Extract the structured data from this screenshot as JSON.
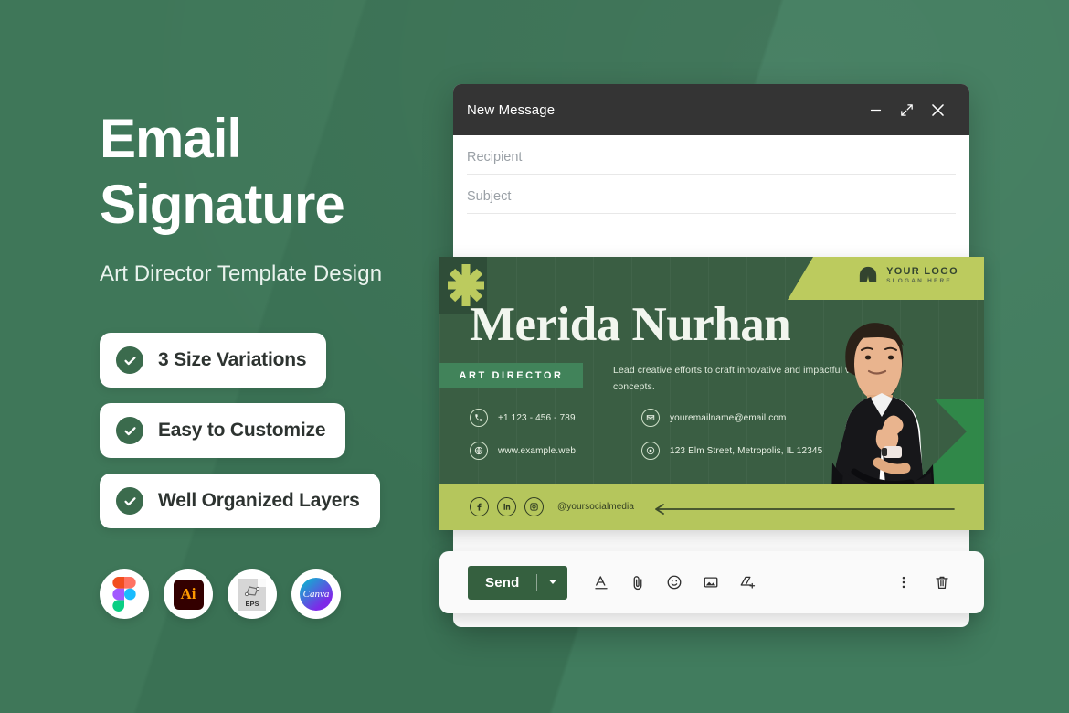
{
  "theme": {
    "background_green": "#417a5c",
    "card_white": "#ffffff",
    "banner_dark_green": "#3a5e43",
    "banner_olive": "#b5c65c",
    "accent_send_green": "#35603f",
    "titlebar_dark": "#343434"
  },
  "promo": {
    "headline_line1": "Email",
    "headline_line2": "Signature",
    "subheading": "Art Director Template Design",
    "features": [
      {
        "label": "3 Size Variations",
        "icon": "check-circle-icon"
      },
      {
        "label": "Easy to Customize",
        "icon": "check-circle-icon"
      },
      {
        "label": "Well Organized Layers",
        "icon": "check-circle-icon"
      }
    ],
    "app_icons": [
      {
        "name": "figma-icon",
        "label": "Figma"
      },
      {
        "name": "illustrator-icon",
        "label": "Ai"
      },
      {
        "name": "eps-file-icon",
        "label": "EPS"
      },
      {
        "name": "canva-icon",
        "label": "Canva"
      }
    ]
  },
  "compose": {
    "title": "New Message",
    "window_buttons": [
      {
        "name": "minimize-icon",
        "label": "Minimize"
      },
      {
        "name": "expand-icon",
        "label": "Expand"
      },
      {
        "name": "close-icon",
        "label": "Close"
      }
    ],
    "fields": [
      {
        "name": "recipient-field",
        "placeholder": "Recipient",
        "value": ""
      },
      {
        "name": "subject-field",
        "placeholder": "Subject",
        "value": ""
      }
    ]
  },
  "signature": {
    "name": "Merida Nurhan",
    "role": "ART DIRECTOR",
    "tagline": "Lead creative efforts to craft innovative and impactful visual concepts.",
    "logo": {
      "title": "YOUR LOGO",
      "slogan": "SLOGAN HERE"
    },
    "contacts": [
      {
        "icon": "phone-icon",
        "text": "+1 123 - 456 - 789"
      },
      {
        "icon": "email-icon",
        "text": "youremailname@email.com"
      },
      {
        "icon": "globe-icon",
        "text": "www.example.web"
      },
      {
        "icon": "location-icon",
        "text": "123 Elm Street, Metropolis, IL 12345"
      }
    ],
    "social": {
      "handle": "@yoursocialmedia",
      "networks": [
        {
          "name": "facebook-icon",
          "label": "Facebook"
        },
        {
          "name": "linkedin-icon",
          "label": "LinkedIn"
        },
        {
          "name": "instagram-icon",
          "label": "Instagram"
        }
      ]
    }
  },
  "toolbar": {
    "send_label": "Send",
    "send_options_icon": "chevron-down-icon",
    "tools": [
      {
        "name": "format-text-icon",
        "label": "Formatting options"
      },
      {
        "name": "attach-file-icon",
        "label": "Attach files"
      },
      {
        "name": "emoji-icon",
        "label": "Insert emoji"
      },
      {
        "name": "insert-photo-icon",
        "label": "Insert photo"
      },
      {
        "name": "insert-drive-icon",
        "label": "Insert from Drive"
      }
    ],
    "right_tools": [
      {
        "name": "more-options-icon",
        "label": "More options"
      },
      {
        "name": "discard-draft-icon",
        "label": "Discard draft"
      }
    ]
  }
}
